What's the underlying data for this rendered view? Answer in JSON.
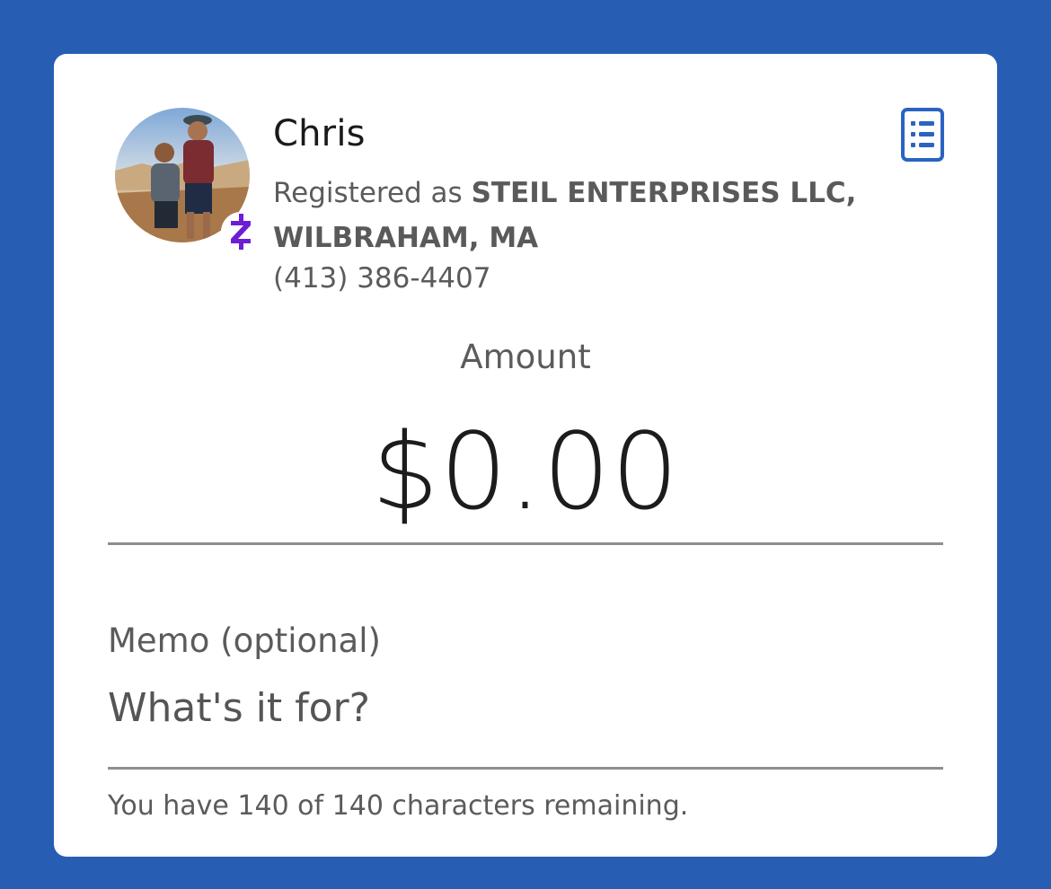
{
  "recipient": {
    "name": "Chris",
    "registered_prefix": "Registered as ",
    "registered_business": "STEIL ENTERPRISES LLC, WILBRAHAM, MA",
    "phone": "(413) 386-4407",
    "badge_icon": "zelle-icon"
  },
  "amount": {
    "label": "Amount",
    "value": "$0.00"
  },
  "memo": {
    "label": "Memo (optional)",
    "placeholder": "What's it for?",
    "value": "",
    "remaining_text": "You have 140 of 140 characters remaining."
  },
  "colors": {
    "background": "#275eb4",
    "accent": "#2a63c2",
    "zelle_purple": "#6d1ed4"
  }
}
